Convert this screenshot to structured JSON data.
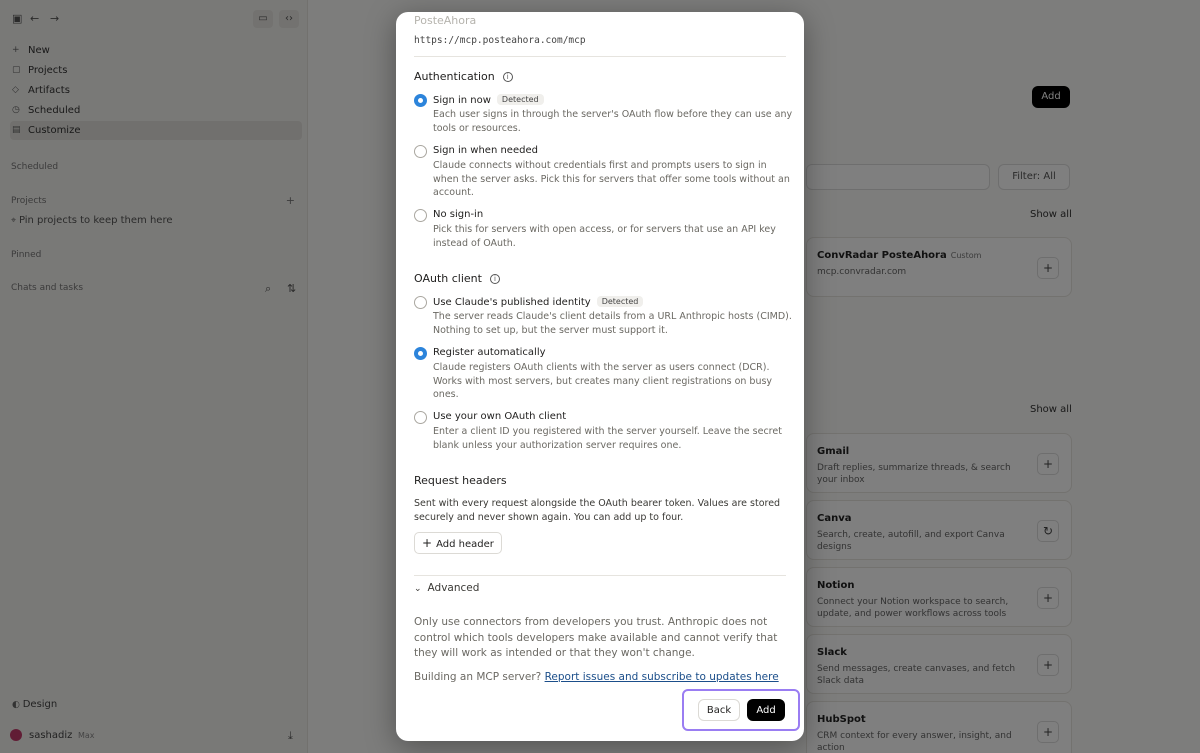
{
  "sidebar": {
    "nav": [
      "New",
      "Projects",
      "Artifacts",
      "Scheduled",
      "Customize"
    ],
    "scheduled_label": "Scheduled",
    "projects_label": "Projects",
    "pin_hint": "Pin projects to keep them here",
    "pinned_label": "Pinned",
    "chats_label": "Chats and tasks",
    "design_label": "Design",
    "user_name": "sashadiz",
    "user_plan": "Max"
  },
  "background": {
    "add_label": "Add",
    "filter_label": "Filter: All",
    "show_all": "Show all",
    "connected_card": {
      "title": "ConvRadar PosteAhora",
      "tag": "Custom",
      "subtitle": "mcp.convradar.com"
    },
    "cards": [
      {
        "title": "Gmail",
        "desc": "Draft replies, summarize threads, & search your inbox",
        "action": "+"
      },
      {
        "title": "Canva",
        "desc": "Search, create, autofill, and export Canva designs",
        "action": "↻"
      },
      {
        "title": "Notion",
        "desc": "Connect your Notion workspace to search, update, and power workflows across tools",
        "action": "+"
      },
      {
        "title": "Slack",
        "desc": "Send messages, create canvases, and fetch Slack data",
        "action": "+"
      },
      {
        "title": "HubSpot",
        "desc": "CRM context for every answer, insight, and action",
        "action": "+"
      }
    ]
  },
  "modal": {
    "server_name": "PosteAhora",
    "server_url": "https://mcp.posteahora.com/mcp",
    "auth": {
      "title": "Authentication",
      "options": [
        {
          "label": "Sign in now",
          "badge": "Detected",
          "desc": "Each user signs in through the server's OAuth flow before they can use any tools or resources."
        },
        {
          "label": "Sign in when needed",
          "badge": "",
          "desc": "Claude connects without credentials first and prompts users to sign in when the server asks. Pick this for servers that offer some tools without an account."
        },
        {
          "label": "No sign-in",
          "badge": "",
          "desc": "Pick this for servers with open access, or for servers that use an API key instead of OAuth."
        }
      ]
    },
    "oauth": {
      "title": "OAuth client",
      "options": [
        {
          "label": "Use Claude's published identity",
          "badge": "Detected",
          "desc": "The server reads Claude's client details from a URL Anthropic hosts (CIMD). Nothing to set up, but the server must support it."
        },
        {
          "label": "Register automatically",
          "badge": "",
          "desc": "Claude registers OAuth clients with the server as users connect (DCR). Works with most servers, but creates many client registrations on busy ones."
        },
        {
          "label": "Use your own OAuth client",
          "badge": "",
          "desc": "Enter a client ID you registered with the server yourself. Leave the secret blank unless your authorization server requires one."
        }
      ]
    },
    "headers": {
      "title": "Request headers",
      "desc": "Sent with every request alongside the OAuth bearer token. Values are stored securely and never shown again. You can add up to four.",
      "add_label": "Add header"
    },
    "advanced_label": "Advanced",
    "disclaimer": "Only use connectors from developers you trust. Anthropic does not control which tools developers make available and cannot verify that they will work as intended or that they won't change.",
    "building_prefix": "Building an MCP server?",
    "building_link": "Report issues and subscribe to updates here",
    "back_label": "Back",
    "add_label": "Add",
    "accent_color": "#2c84db",
    "highlight_color": "#9a7df2"
  }
}
